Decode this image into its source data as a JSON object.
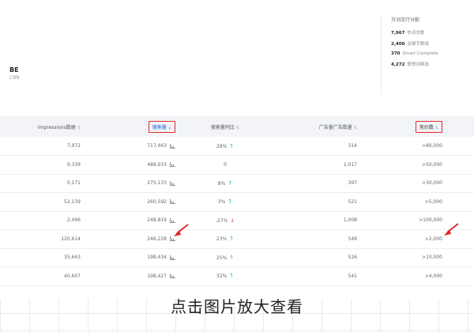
{
  "kpi": {
    "value": "ΒΕ",
    "label": "CBN"
  },
  "summary": {
    "title": "万词流行分配",
    "rows": [
      {
        "num": "7,967",
        "text": "热词总数"
      },
      {
        "num": "2,400",
        "text": "关键字数组"
      },
      {
        "num": "370",
        "text": "Smart Complete"
      },
      {
        "num": "4,272",
        "text": "联想词候选"
      }
    ]
  },
  "table": {
    "headers": [
      "Impressions数据",
      "搜索量",
      "搜索量同比",
      "广告量广告数量",
      "竞价数"
    ],
    "rows": [
      {
        "impressions": "7,972",
        "volume": "717,463",
        "yoy": "28%",
        "yoy_trend": "up",
        "ads": "314",
        "bid": ">80,000"
      },
      {
        "impressions": "9,339",
        "volume": "488,933",
        "yoy": "0",
        "yoy_trend": "none",
        "ads": "1,017",
        "bid": ">50,000"
      },
      {
        "impressions": "0,171",
        "volume": "275,133",
        "yoy": "8%",
        "yoy_trend": "up",
        "ads": "397",
        "bid": ">30,000"
      },
      {
        "impressions": "52,139",
        "volume": "260,592",
        "yoy": "3%",
        "yoy_trend": "up",
        "ads": "521",
        "bid": ">5,000"
      },
      {
        "impressions": "2,496",
        "volume": "248,819",
        "yoy": "-27%",
        "yoy_trend": "down",
        "ads": "1,008",
        "bid": ">100,000"
      },
      {
        "impressions": "120,614",
        "volume": "246,228",
        "yoy": "23%",
        "yoy_trend": "up",
        "ads": "549",
        "bid": ">2,000"
      },
      {
        "impressions": "35,643",
        "volume": "198,434",
        "yoy": "25%",
        "yoy_trend": "up",
        "ads": "526",
        "bid": ">10,000"
      },
      {
        "impressions": "40,607",
        "volume": "198,427",
        "yoy": "32%",
        "yoy_trend": "up",
        "ads": "541",
        "bid": ">4,000"
      }
    ]
  },
  "caption": "点击图片放大查看",
  "colors": {
    "highlight_box": "#e12a2a",
    "sort_active": "#1f5fd6",
    "up": "#2bb673",
    "down": "#e04040",
    "header_bg": "#f2f4f8"
  },
  "icons": {
    "trend_chart": "bar-chart-icon",
    "sort": "sort-icon",
    "sort_active": "sort-desc-icon"
  }
}
